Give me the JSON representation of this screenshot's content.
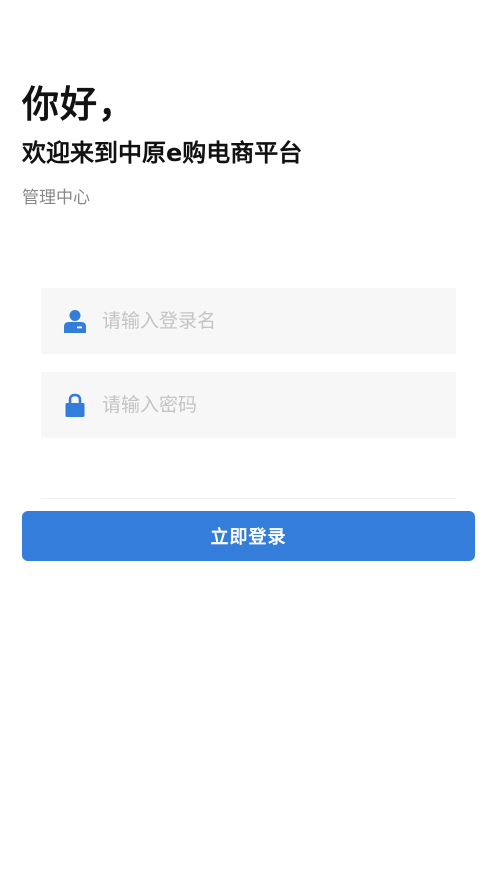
{
  "header": {
    "greeting": "你好，",
    "welcome": "欢迎来到中原e购电商平台",
    "subtitle": "管理中心"
  },
  "form": {
    "username": {
      "placeholder": "请输入登录名",
      "value": "",
      "icon": "user-icon"
    },
    "password": {
      "placeholder": "请输入密码",
      "value": "",
      "icon": "lock-icon"
    },
    "submit_label": "立即登录"
  },
  "colors": {
    "accent": "#347ddb",
    "field_background": "#f7f7f7",
    "placeholder": "#c4c4c4",
    "subtitle": "#888888"
  }
}
